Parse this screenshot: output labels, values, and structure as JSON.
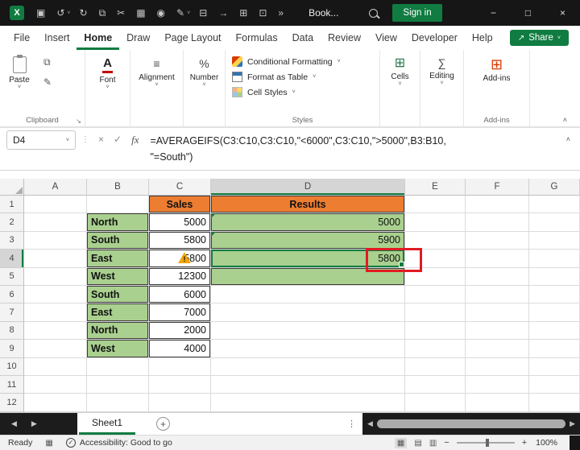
{
  "colors": {
    "excel_green": "#107C41",
    "accent_orange": "#ED7D31",
    "cell_green": "#A9D08E",
    "annotation_red": "#E11B22"
  },
  "title_bar": {
    "logo_letter": "X",
    "workbook_name": "Book...",
    "sign_in_label": "Sign in",
    "icons": {
      "save": "▣",
      "undo": "↺",
      "redo": "↻",
      "clipboard": "⧉",
      "cut": "✂",
      "chart": "▦",
      "badge": "◉",
      "painter": "✎",
      "printer": "⊟",
      "export": "→",
      "table": "⊞",
      "cell": "⊡",
      "overflow": "»",
      "chevron": "˅",
      "minimize": "−",
      "maximize": "□",
      "close": "×"
    }
  },
  "menu_bar": {
    "items": [
      "File",
      "Insert",
      "Home",
      "Draw",
      "Page Layout",
      "Formulas",
      "Data",
      "Review",
      "View",
      "Developer",
      "Help"
    ],
    "active_item": "Home",
    "share_icon": "↗",
    "share_label": "Share",
    "share_chevron": "˅"
  },
  "ribbon": {
    "paste": {
      "label": "Paste",
      "chevron": "˅"
    },
    "clipboard_group": "Clipboard",
    "launcher": "↘",
    "copy_icon": "⧉",
    "painter_icon": "✎",
    "font": {
      "icon": "A",
      "label": "Font",
      "chevron": "˅"
    },
    "alignment": {
      "icon": "≡",
      "label": "Alignment",
      "chevron": "˅"
    },
    "number": {
      "icon": "%",
      "label": "Number",
      "chevron": "˅"
    },
    "styles": {
      "items": [
        {
          "label": "Conditional Formatting",
          "chevron": "˅"
        },
        {
          "label": "Format as Table",
          "chevron": "˅"
        },
        {
          "label": "Cell Styles",
          "chevron": "˅"
        }
      ],
      "group_label": "Styles"
    },
    "cells": {
      "icon": "⊞",
      "label": "Cells",
      "chevron": "˅"
    },
    "editing": {
      "icon": "∑",
      "label": "Editing",
      "chevron": "˅"
    },
    "addins": {
      "icon": "⊞",
      "label": "Add-ins",
      "group_label": "Add-ins"
    },
    "collapse_chevron": "˄"
  },
  "formula_bar": {
    "name_box": "D4",
    "name_chevron": "˅",
    "dots": "⋮",
    "cancel": "×",
    "enter": "✓",
    "fx": "fx",
    "formula_line1": "=AVERAGEIFS(C3:C10,C3:C10,\"<6000\",C3:C10,\">5000\",B3:B10,",
    "formula_line2": "\"=South\")",
    "collapse": "˄"
  },
  "grid": {
    "column_headers": [
      "A",
      "B",
      "C",
      "D",
      "E",
      "F",
      "G"
    ],
    "row_headers": [
      "1",
      "2",
      "3",
      "4",
      "5",
      "6",
      "7",
      "8",
      "9",
      "10",
      "11",
      "12"
    ],
    "active_cell": "D4",
    "table": {
      "sales_header": "Sales",
      "results_header": "Results",
      "rows": [
        {
          "region": "North",
          "sales": "5000",
          "result": "5000"
        },
        {
          "region": "South",
          "sales": "5800",
          "result": "5900"
        },
        {
          "region": "East",
          "sales": "5800",
          "result": "5800"
        },
        {
          "region": "West",
          "sales": "12300",
          "result": ""
        },
        {
          "region": "South",
          "sales": "6000"
        },
        {
          "region": "East",
          "sales": "7000"
        },
        {
          "region": "North",
          "sales": "2000"
        },
        {
          "region": "West",
          "sales": "4000"
        }
      ]
    }
  },
  "sheet_bar": {
    "prev": "◀",
    "next": "▶",
    "tabs": [
      "Sheet1"
    ],
    "add": "+",
    "dots": "⋮",
    "scroll_left": "◀",
    "scroll_right": "▶"
  },
  "status_bar": {
    "mode": "Ready",
    "macro_icon": "▦",
    "accessibility_icon": "✓",
    "accessibility": "Accessibility: Good to go",
    "view_normal": "▦",
    "view_layout": "▤",
    "view_break": "▥",
    "zoom_out": "−",
    "zoom_in": "+",
    "zoom": "100%"
  }
}
